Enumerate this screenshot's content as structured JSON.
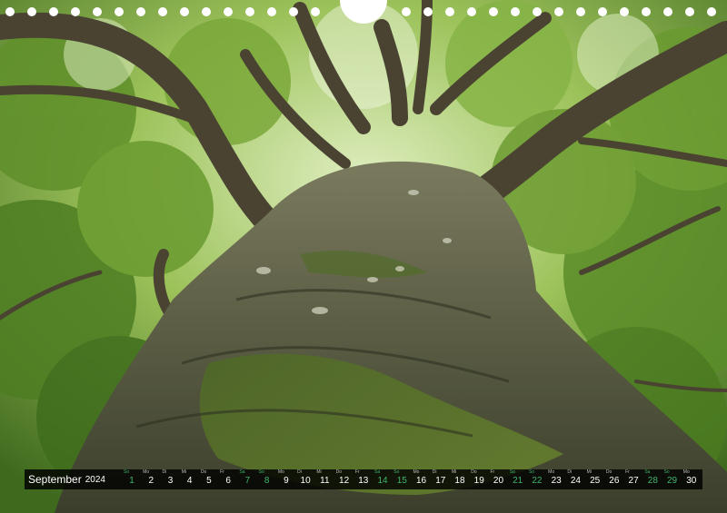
{
  "calendar": {
    "month": "September",
    "year": "2024",
    "days": [
      {
        "n": "1",
        "wd": "So",
        "weekend": true
      },
      {
        "n": "2",
        "wd": "Mo",
        "weekend": false
      },
      {
        "n": "3",
        "wd": "Di",
        "weekend": false
      },
      {
        "n": "4",
        "wd": "Mi",
        "weekend": false
      },
      {
        "n": "5",
        "wd": "Do",
        "weekend": false
      },
      {
        "n": "6",
        "wd": "Fr",
        "weekend": false
      },
      {
        "n": "7",
        "wd": "Sa",
        "weekend": true
      },
      {
        "n": "8",
        "wd": "So",
        "weekend": true
      },
      {
        "n": "9",
        "wd": "Mo",
        "weekend": false
      },
      {
        "n": "10",
        "wd": "Di",
        "weekend": false
      },
      {
        "n": "11",
        "wd": "Mi",
        "weekend": false
      },
      {
        "n": "12",
        "wd": "Do",
        "weekend": false
      },
      {
        "n": "13",
        "wd": "Fr",
        "weekend": false
      },
      {
        "n": "14",
        "wd": "Sa",
        "weekend": true
      },
      {
        "n": "15",
        "wd": "So",
        "weekend": true
      },
      {
        "n": "16",
        "wd": "Mo",
        "weekend": false
      },
      {
        "n": "17",
        "wd": "Di",
        "weekend": false
      },
      {
        "n": "18",
        "wd": "Mi",
        "weekend": false
      },
      {
        "n": "19",
        "wd": "Do",
        "weekend": false
      },
      {
        "n": "20",
        "wd": "Fr",
        "weekend": false
      },
      {
        "n": "21",
        "wd": "Sa",
        "weekend": true
      },
      {
        "n": "22",
        "wd": "So",
        "weekend": true
      },
      {
        "n": "23",
        "wd": "Mo",
        "weekend": false
      },
      {
        "n": "24",
        "wd": "Di",
        "weekend": false
      },
      {
        "n": "25",
        "wd": "Mi",
        "weekend": false
      },
      {
        "n": "26",
        "wd": "Do",
        "weekend": false
      },
      {
        "n": "27",
        "wd": "Fr",
        "weekend": false
      },
      {
        "n": "28",
        "wd": "Sa",
        "weekend": true
      },
      {
        "n": "29",
        "wd": "So",
        "weekend": true
      },
      {
        "n": "30",
        "wd": "Mo",
        "weekend": false
      }
    ]
  },
  "colors": {
    "weekend": "#3fb56a",
    "weekday": "#ffffff",
    "bar": "#000000"
  },
  "icons": {
    "binding_hole": "binding-hole-icon",
    "hanger": "hanger-cutout-icon"
  }
}
